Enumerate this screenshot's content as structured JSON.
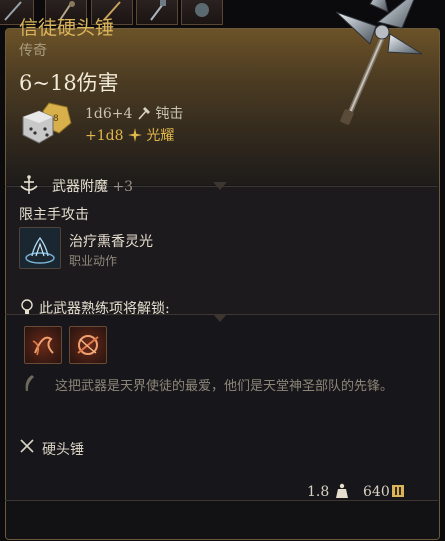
{
  "item": {
    "name": "信徒硬头锤",
    "rarity": "传奇",
    "damage_total": "6~18伤害",
    "damage_lines": [
      {
        "dice": "1d6+4",
        "type": "钝击"
      },
      {
        "dice": "+1d8",
        "type": "光耀"
      }
    ]
  },
  "enchant": {
    "label": "武器附魔",
    "value": "+3"
  },
  "restriction": "限主手攻击",
  "spell": {
    "name": "治疗熏香灵光",
    "type": "职业动作"
  },
  "proficiency": {
    "label": "此武器熟练项将解锁:"
  },
  "flavor_text": "这把武器是天界使徒的最爱，他们是天堂神圣部队的先锋。",
  "weapon_type": "硬头锤",
  "footer": {
    "weight": "1.8",
    "price": "640"
  },
  "icons": {
    "weapon": "mace-icon",
    "dice": "dice-icon",
    "bludgeon": "hammer-icon",
    "radiant": "sparkle-icon",
    "enchant": "enchant-icon",
    "spell": "incense-aura-icon",
    "proficiency": "lightbulb-icon",
    "flavor": "quill-icon",
    "weapon_type": "crossed-weapons-icon",
    "weight": "weight-icon",
    "coin": "coin-icon"
  },
  "colors": {
    "name": "#d9b45a",
    "radiant": "#e2b64a",
    "text": "#e6dfcf",
    "muted": "#8c8679"
  }
}
